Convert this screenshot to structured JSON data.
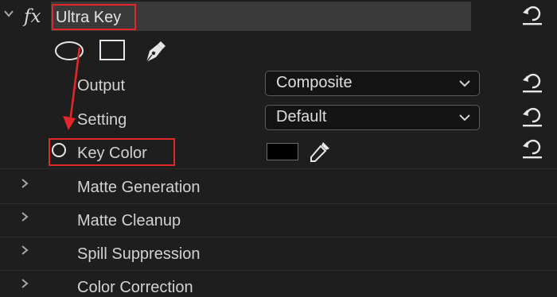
{
  "effect": {
    "title": "Ultra Key",
    "fx_label": "fx"
  },
  "mask_tools": [
    "ellipse-mask",
    "rectangle-mask",
    "pen-mask"
  ],
  "properties": {
    "output": {
      "label": "Output",
      "value": "Composite"
    },
    "setting": {
      "label": "Setting",
      "value": "Default"
    },
    "key_color": {
      "label": "Key Color",
      "color": "#000000"
    }
  },
  "groups": [
    "Matte Generation",
    "Matte Cleanup",
    "Spill Suppression",
    "Color Correction"
  ],
  "annotation_color": "#e2262a"
}
